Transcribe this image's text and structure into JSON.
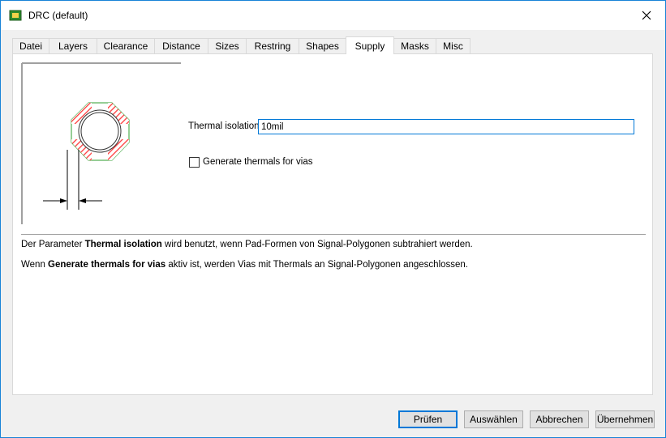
{
  "window": {
    "title": "DRC (default)"
  },
  "tabs": [
    "Datei",
    "Layers",
    "Clearance",
    "Distance",
    "Sizes",
    "Restring",
    "Shapes",
    "Supply",
    "Masks",
    "Misc"
  ],
  "active_tab": "Supply",
  "supply": {
    "thermal_isolation_label": "Thermal isolation",
    "thermal_isolation_value": "10mil",
    "generate_thermals_label": "Generate thermals for vias",
    "generate_thermals_checked": false
  },
  "description": {
    "line1_a": "Der Parameter ",
    "line1_b": "Thermal isolation",
    "line1_c": " wird benutzt, wenn Pad-Formen von Signal-Polygonen subtrahiert werden.",
    "line2_a": "Wenn ",
    "line2_b": "Generate thermals for vias",
    "line2_c": " aktiv ist, werden Vias mit Thermals an Signal-Polygonen angeschlossen."
  },
  "buttons": {
    "check": "Prüfen",
    "select": "Auswählen",
    "cancel": "Abbrechen",
    "apply": "Übernehmen"
  },
  "colors": {
    "accent": "#0078d7",
    "thermal_hatch": "#ff3b3b",
    "pad_outline": "#2e9e2e"
  }
}
